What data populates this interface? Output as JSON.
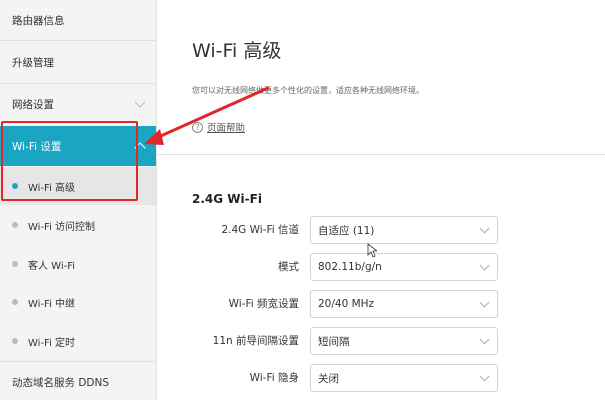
{
  "sidebar": {
    "items": [
      {
        "label": "路由器信息"
      },
      {
        "label": "升级管理"
      },
      {
        "label": "网络设置"
      },
      {
        "label": "Wi-Fi 设置"
      }
    ],
    "wifi_subitems": [
      {
        "label": "Wi-Fi 高级"
      },
      {
        "label": "Wi-Fi 访问控制"
      },
      {
        "label": "客人 Wi-Fi"
      },
      {
        "label": "Wi-Fi 中继"
      },
      {
        "label": "Wi-Fi 定时"
      }
    ],
    "bottom_item": "动态域名服务 DDNS"
  },
  "main": {
    "title": "Wi-Fi 高级",
    "description": "您可以对无线网络做更多个性化的设置，适应各种无线网络环境。",
    "help_icon": "question-circle-icon",
    "help_label": "页面帮助",
    "section_title": "2.4G Wi-Fi",
    "settings": [
      {
        "label": "2.4G Wi-Fi 信道",
        "value": "自适应 (11)"
      },
      {
        "label": "模式",
        "value": "802.11b/g/n"
      },
      {
        "label": "Wi-Fi 频宽设置",
        "value": "20/40 MHz"
      },
      {
        "label": "11n 前导间隔设置",
        "value": "短间隔"
      },
      {
        "label": "Wi-Fi 隐身",
        "value": "关闭"
      }
    ]
  },
  "colors": {
    "accent": "#1aa5c2",
    "annotation": "#e0272a"
  }
}
